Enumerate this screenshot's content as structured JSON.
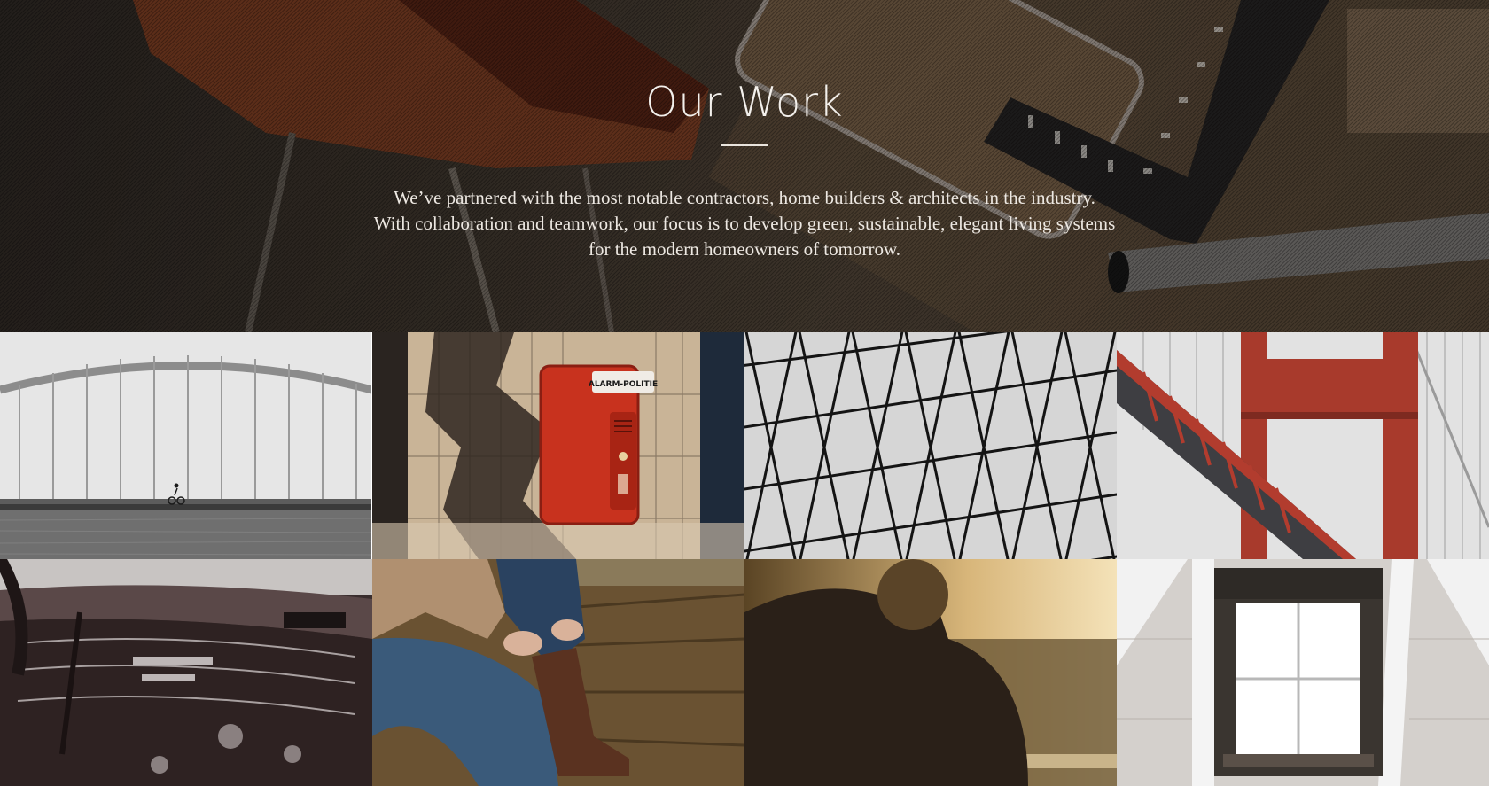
{
  "hero": {
    "title": "Our Work",
    "lines": [
      "We’ve partnered with the most notable contractors, home builders & architects in the industry.",
      "With collaboration and teamwork, our focus is to develop green, sustainable, elegant living systems",
      "for the modern homeowners of tomorrow."
    ]
  },
  "gallery": {
    "images": [
      {
        "subject": "bridge-with-cyclist"
      },
      {
        "subject": "red-alarm-box"
      },
      {
        "subject": "triangular-glass-roof"
      },
      {
        "subject": "red-suspension-bridge"
      },
      {
        "subject": "vintage-car-dashboard"
      },
      {
        "subject": "person-pulling-boot"
      },
      {
        "subject": "man-at-sunset"
      },
      {
        "subject": "attic-window"
      }
    ],
    "alarm_box_label": "ALARM-POLITIE"
  },
  "colors": {
    "title": "#f3f0ec",
    "body_text": "#ede8e2",
    "alarm_red": "#c8321e",
    "bridge_red": "#a83a2c"
  }
}
